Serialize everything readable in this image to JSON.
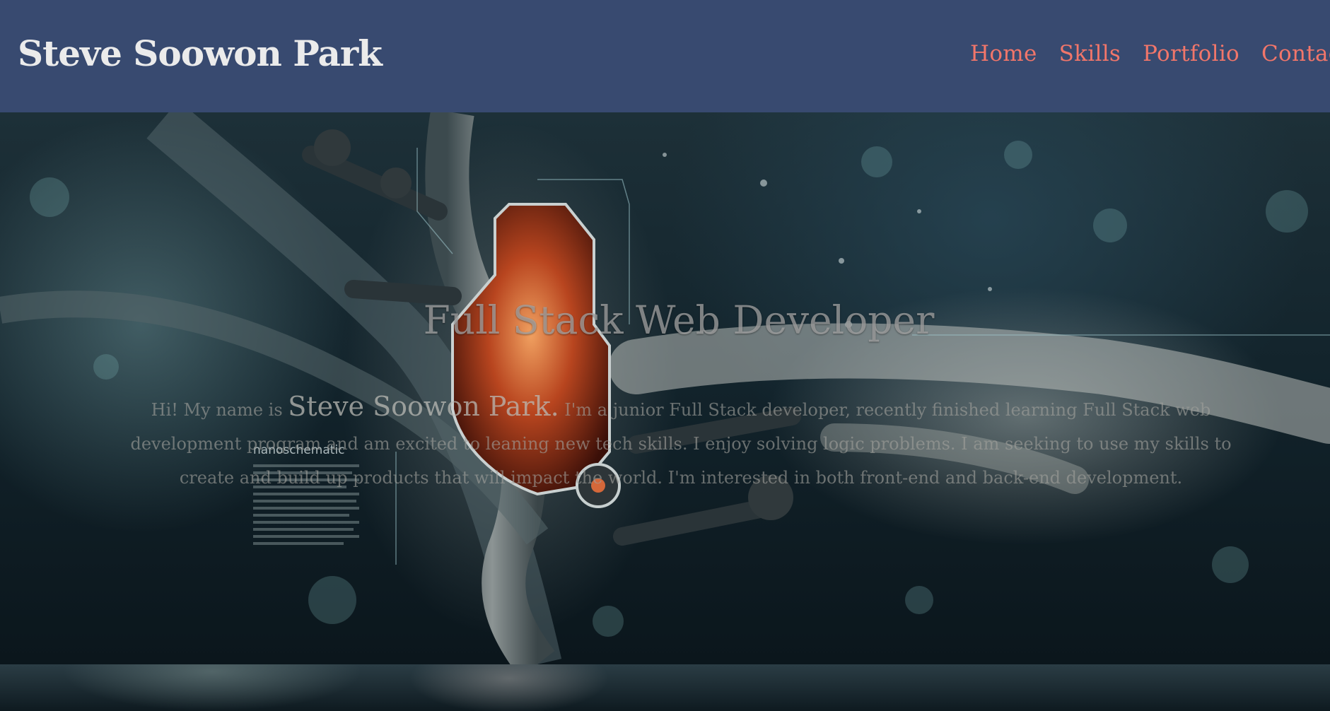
{
  "header": {
    "brand": "Steve Soowon Park",
    "nav": [
      {
        "label": "Home"
      },
      {
        "label": "Skills"
      },
      {
        "label": "Portfolio"
      },
      {
        "label": "Contact"
      }
    ]
  },
  "hero": {
    "title": "Full Stack Web Developer",
    "intro_prefix": "Hi! My name is ",
    "name": "Steve Soowon Park.",
    "intro_body": " I'm a junior Full Stack developer, recently finished learning Full Stack web development program and am excited to leaning new tech skills. I enjoy solving logic problems. I am seeking to use my skills to create and build up products that will impact the world. I'm interested in both front-end and back-end development.",
    "overlay_label": "nanoschematic"
  },
  "colors": {
    "navbar_bg": "#384a70",
    "brand_text": "#ebebeb",
    "nav_link": "#f2766a"
  }
}
